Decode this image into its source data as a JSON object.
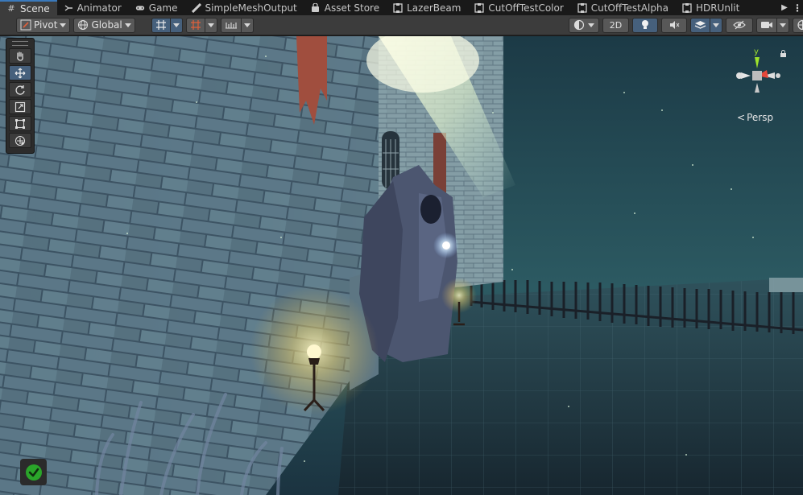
{
  "tabs": [
    {
      "label": "Scene",
      "icon": "grid-hash-icon",
      "active": true
    },
    {
      "label": "Animator",
      "icon": "animator-icon"
    },
    {
      "label": "Game",
      "icon": "gamepad-icon"
    },
    {
      "label": "SimpleMeshOutput",
      "icon": "vfx-icon"
    },
    {
      "label": "Asset Store",
      "icon": "bag-icon"
    },
    {
      "label": "LazerBeam",
      "icon": "graph-icon"
    },
    {
      "label": "CutOffTestColor",
      "icon": "graph-icon"
    },
    {
      "label": "CutOffTestAlpha",
      "icon": "graph-icon"
    },
    {
      "label": "HDRUnlit",
      "icon": "graph-icon"
    }
  ],
  "toolbar": {
    "pivot_label": "Pivot",
    "global_label": "Global",
    "mode_2d_label": "2D"
  },
  "gizmo": {
    "projection_label": "Persp",
    "y_axis_color": "#9ee22c",
    "x_axis_color": "#e5473a"
  },
  "status": {
    "icon": "checkmark-icon",
    "color": "#2aa52a"
  },
  "colors": {
    "accent": "#3a79bb",
    "toggle_on": "#46607c"
  }
}
